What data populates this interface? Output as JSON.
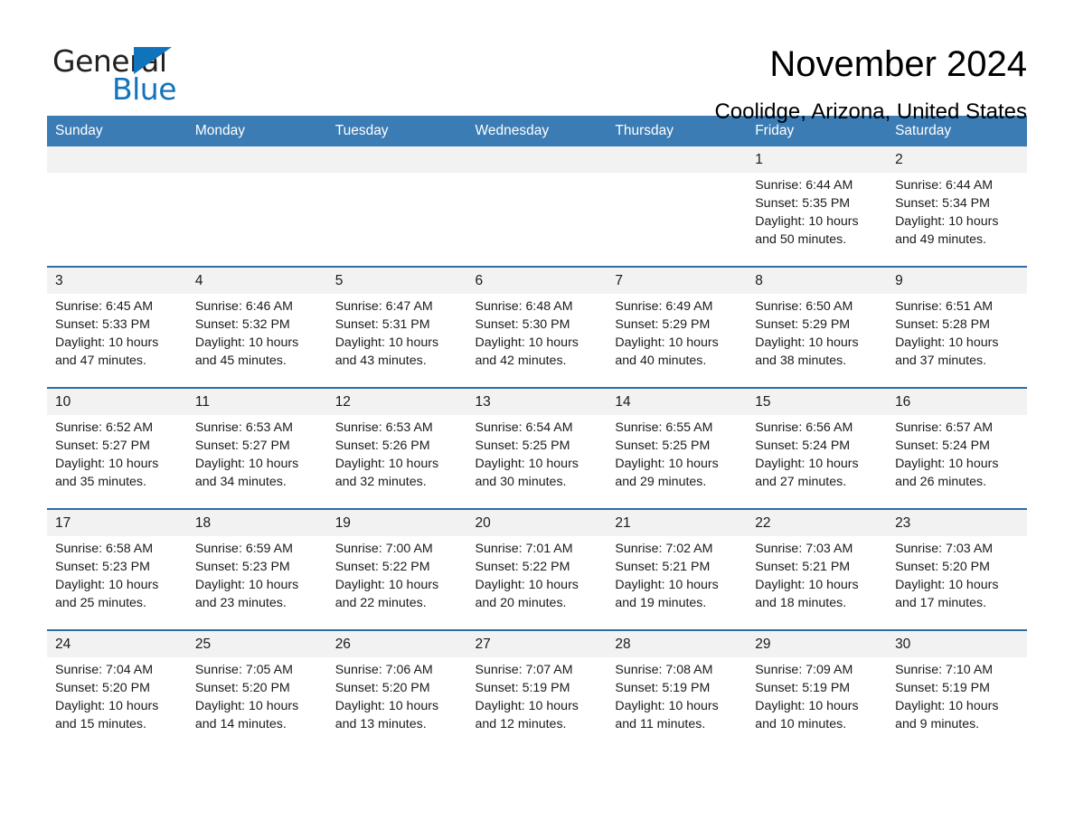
{
  "logo": {
    "word1": "General",
    "word2": "Blue",
    "triangle_color": "#1273bd"
  },
  "header": {
    "title": "November 2024",
    "location": "Coolidge, Arizona, United States",
    "accent_color": "#3b7cb5",
    "row_divider_color": "#2f6ca3",
    "daynum_bg": "#f2f2f2"
  },
  "weekdays": [
    "Sunday",
    "Monday",
    "Tuesday",
    "Wednesday",
    "Thursday",
    "Friday",
    "Saturday"
  ],
  "labels": {
    "sunrise_prefix": "Sunrise: ",
    "sunset_prefix": "Sunset: ",
    "daylight_prefix": "Daylight: "
  },
  "weeks": [
    [
      {
        "blank": true,
        "day": ""
      },
      {
        "blank": true,
        "day": ""
      },
      {
        "blank": true,
        "day": ""
      },
      {
        "blank": true,
        "day": ""
      },
      {
        "blank": true,
        "day": ""
      },
      {
        "blank": false,
        "day": "1",
        "sunrise": "Sunrise: 6:44 AM",
        "sunset": "Sunset: 5:35 PM",
        "daylight": "Daylight: 10 hours and 50 minutes."
      },
      {
        "blank": false,
        "day": "2",
        "sunrise": "Sunrise: 6:44 AM",
        "sunset": "Sunset: 5:34 PM",
        "daylight": "Daylight: 10 hours and 49 minutes."
      }
    ],
    [
      {
        "blank": false,
        "day": "3",
        "sunrise": "Sunrise: 6:45 AM",
        "sunset": "Sunset: 5:33 PM",
        "daylight": "Daylight: 10 hours and 47 minutes."
      },
      {
        "blank": false,
        "day": "4",
        "sunrise": "Sunrise: 6:46 AM",
        "sunset": "Sunset: 5:32 PM",
        "daylight": "Daylight: 10 hours and 45 minutes."
      },
      {
        "blank": false,
        "day": "5",
        "sunrise": "Sunrise: 6:47 AM",
        "sunset": "Sunset: 5:31 PM",
        "daylight": "Daylight: 10 hours and 43 minutes."
      },
      {
        "blank": false,
        "day": "6",
        "sunrise": "Sunrise: 6:48 AM",
        "sunset": "Sunset: 5:30 PM",
        "daylight": "Daylight: 10 hours and 42 minutes."
      },
      {
        "blank": false,
        "day": "7",
        "sunrise": "Sunrise: 6:49 AM",
        "sunset": "Sunset: 5:29 PM",
        "daylight": "Daylight: 10 hours and 40 minutes."
      },
      {
        "blank": false,
        "day": "8",
        "sunrise": "Sunrise: 6:50 AM",
        "sunset": "Sunset: 5:29 PM",
        "daylight": "Daylight: 10 hours and 38 minutes."
      },
      {
        "blank": false,
        "day": "9",
        "sunrise": "Sunrise: 6:51 AM",
        "sunset": "Sunset: 5:28 PM",
        "daylight": "Daylight: 10 hours and 37 minutes."
      }
    ],
    [
      {
        "blank": false,
        "day": "10",
        "sunrise": "Sunrise: 6:52 AM",
        "sunset": "Sunset: 5:27 PM",
        "daylight": "Daylight: 10 hours and 35 minutes."
      },
      {
        "blank": false,
        "day": "11",
        "sunrise": "Sunrise: 6:53 AM",
        "sunset": "Sunset: 5:27 PM",
        "daylight": "Daylight: 10 hours and 34 minutes."
      },
      {
        "blank": false,
        "day": "12",
        "sunrise": "Sunrise: 6:53 AM",
        "sunset": "Sunset: 5:26 PM",
        "daylight": "Daylight: 10 hours and 32 minutes."
      },
      {
        "blank": false,
        "day": "13",
        "sunrise": "Sunrise: 6:54 AM",
        "sunset": "Sunset: 5:25 PM",
        "daylight": "Daylight: 10 hours and 30 minutes."
      },
      {
        "blank": false,
        "day": "14",
        "sunrise": "Sunrise: 6:55 AM",
        "sunset": "Sunset: 5:25 PM",
        "daylight": "Daylight: 10 hours and 29 minutes."
      },
      {
        "blank": false,
        "day": "15",
        "sunrise": "Sunrise: 6:56 AM",
        "sunset": "Sunset: 5:24 PM",
        "daylight": "Daylight: 10 hours and 27 minutes."
      },
      {
        "blank": false,
        "day": "16",
        "sunrise": "Sunrise: 6:57 AM",
        "sunset": "Sunset: 5:24 PM",
        "daylight": "Daylight: 10 hours and 26 minutes."
      }
    ],
    [
      {
        "blank": false,
        "day": "17",
        "sunrise": "Sunrise: 6:58 AM",
        "sunset": "Sunset: 5:23 PM",
        "daylight": "Daylight: 10 hours and 25 minutes."
      },
      {
        "blank": false,
        "day": "18",
        "sunrise": "Sunrise: 6:59 AM",
        "sunset": "Sunset: 5:23 PM",
        "daylight": "Daylight: 10 hours and 23 minutes."
      },
      {
        "blank": false,
        "day": "19",
        "sunrise": "Sunrise: 7:00 AM",
        "sunset": "Sunset: 5:22 PM",
        "daylight": "Daylight: 10 hours and 22 minutes."
      },
      {
        "blank": false,
        "day": "20",
        "sunrise": "Sunrise: 7:01 AM",
        "sunset": "Sunset: 5:22 PM",
        "daylight": "Daylight: 10 hours and 20 minutes."
      },
      {
        "blank": false,
        "day": "21",
        "sunrise": "Sunrise: 7:02 AM",
        "sunset": "Sunset: 5:21 PM",
        "daylight": "Daylight: 10 hours and 19 minutes."
      },
      {
        "blank": false,
        "day": "22",
        "sunrise": "Sunrise: 7:03 AM",
        "sunset": "Sunset: 5:21 PM",
        "daylight": "Daylight: 10 hours and 18 minutes."
      },
      {
        "blank": false,
        "day": "23",
        "sunrise": "Sunrise: 7:03 AM",
        "sunset": "Sunset: 5:20 PM",
        "daylight": "Daylight: 10 hours and 17 minutes."
      }
    ],
    [
      {
        "blank": false,
        "day": "24",
        "sunrise": "Sunrise: 7:04 AM",
        "sunset": "Sunset: 5:20 PM",
        "daylight": "Daylight: 10 hours and 15 minutes."
      },
      {
        "blank": false,
        "day": "25",
        "sunrise": "Sunrise: 7:05 AM",
        "sunset": "Sunset: 5:20 PM",
        "daylight": "Daylight: 10 hours and 14 minutes."
      },
      {
        "blank": false,
        "day": "26",
        "sunrise": "Sunrise: 7:06 AM",
        "sunset": "Sunset: 5:20 PM",
        "daylight": "Daylight: 10 hours and 13 minutes."
      },
      {
        "blank": false,
        "day": "27",
        "sunrise": "Sunrise: 7:07 AM",
        "sunset": "Sunset: 5:19 PM",
        "daylight": "Daylight: 10 hours and 12 minutes."
      },
      {
        "blank": false,
        "day": "28",
        "sunrise": "Sunrise: 7:08 AM",
        "sunset": "Sunset: 5:19 PM",
        "daylight": "Daylight: 10 hours and 11 minutes."
      },
      {
        "blank": false,
        "day": "29",
        "sunrise": "Sunrise: 7:09 AM",
        "sunset": "Sunset: 5:19 PM",
        "daylight": "Daylight: 10 hours and 10 minutes."
      },
      {
        "blank": false,
        "day": "30",
        "sunrise": "Sunrise: 7:10 AM",
        "sunset": "Sunset: 5:19 PM",
        "daylight": "Daylight: 10 hours and 9 minutes."
      }
    ]
  ]
}
